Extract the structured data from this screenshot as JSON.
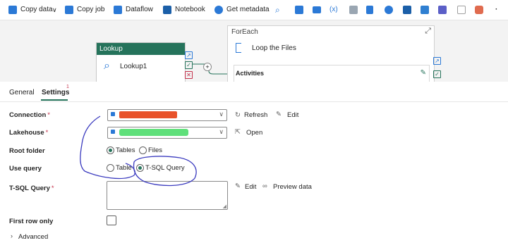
{
  "toolbar": {
    "copy_data": "Copy data",
    "copy_job": "Copy job",
    "dataflow": "Dataflow",
    "notebook": "Notebook",
    "get_metadata": "Get metadata",
    "variables": "(x)",
    "more": "·"
  },
  "canvas": {
    "lookup_title": "Lookup",
    "lookup_name": "Lookup1",
    "plus": "+",
    "foreach_title": "ForEach",
    "foreach_name": "Loop the Files",
    "activities_label": "Activities",
    "expand_glyph": "⤢"
  },
  "tabs": {
    "general": "General",
    "settings": "Settings",
    "settings_badge": "1"
  },
  "form": {
    "required_mark": "*",
    "connection_label": "Connection",
    "refresh": "Refresh",
    "edit": "Edit",
    "lakehouse_label": "Lakehouse",
    "open": "Open",
    "root_folder_label": "Root folder",
    "root_options": [
      "Tables",
      "Files"
    ],
    "use_query_label": "Use query",
    "query_options": [
      "Table",
      "T-SQL Query"
    ],
    "tsql_query_label": "T-SQL Query",
    "preview_data": "Preview data",
    "first_row_label": "First row only",
    "advanced": "Advanced"
  },
  "colors": {
    "accent": "#25735b",
    "required": "#c4314b",
    "ink_annotation": "#3b3bbf",
    "redaction_red": "#e8522a",
    "redaction_green": "#5fe07a"
  }
}
